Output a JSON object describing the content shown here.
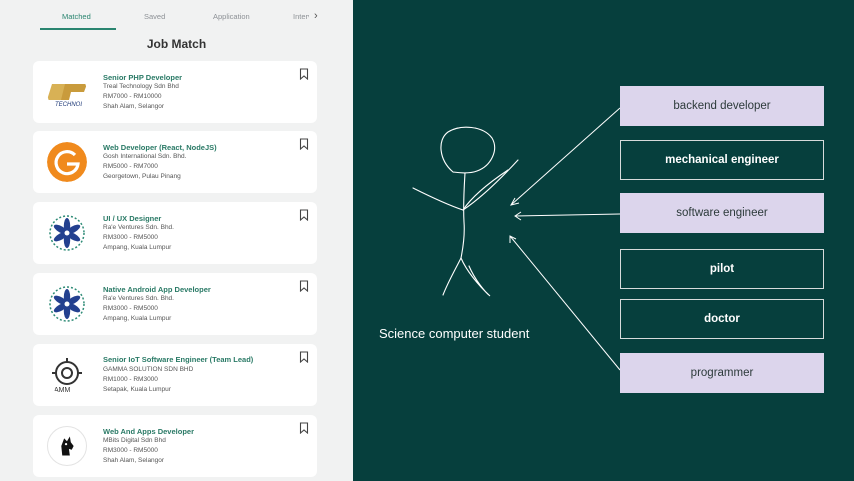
{
  "tabs": [
    {
      "label": "Matched"
    },
    {
      "label": "Saved"
    },
    {
      "label": "Application"
    },
    {
      "label": "Interview"
    }
  ],
  "page_title": "Job Match",
  "jobs": [
    {
      "title": "Senior PHP Developer",
      "company": "Treal Technology Sdn Bhd",
      "salary": "RM7000 - RM10000",
      "location": "Shah Alam, Selangor",
      "logo": "treal-logo",
      "logo_text": "TECHNOL"
    },
    {
      "title": "Web Developer (React, NodeJS)",
      "company": "Gosh International Sdn. Bhd.",
      "salary": "RM5000 - RM7000",
      "location": "Georgetown, Pulau Pinang",
      "logo": "gosh-logo"
    },
    {
      "title": "UI / UX Designer",
      "company": "Ra'e Ventures Sdn. Bhd.",
      "salary": "RM3000 - RM5000",
      "location": "Ampang, Kuala Lumpur",
      "logo": "rae-logo"
    },
    {
      "title": "Native Android App Developer",
      "company": "Ra'e Ventures Sdn. Bhd.",
      "salary": "RM3000 - RM5000",
      "location": "Ampang, Kuala Lumpur",
      "logo": "rae-logo"
    },
    {
      "title": "Senior IoT Software Engineer (Team Lead)",
      "company": "GAMMA SOLUTION SDN BHD",
      "salary": "RM1000 - RM3000",
      "location": "Setapak, Kuala Lumpur",
      "logo": "gamma-logo",
      "logo_text": "AMM"
    },
    {
      "title": "Web And Apps Developer",
      "company": "MBits Digital Sdn Bhd",
      "salary": "RM3000 - RM5000",
      "location": "Shah Alam, Selangor",
      "logo": "mbits-logo"
    }
  ],
  "slide": {
    "careers": [
      {
        "label": "backend developer"
      },
      {
        "label": "mechanical engineer"
      },
      {
        "label": "software engineer"
      },
      {
        "label": "pilot"
      },
      {
        "label": "doctor"
      },
      {
        "label": "programmer"
      }
    ],
    "student_label": "Science computer student"
  },
  "colors": {
    "accent": "#2a8570",
    "slide_bg": "#063f3d",
    "box_fill": "#dcd5ec"
  }
}
